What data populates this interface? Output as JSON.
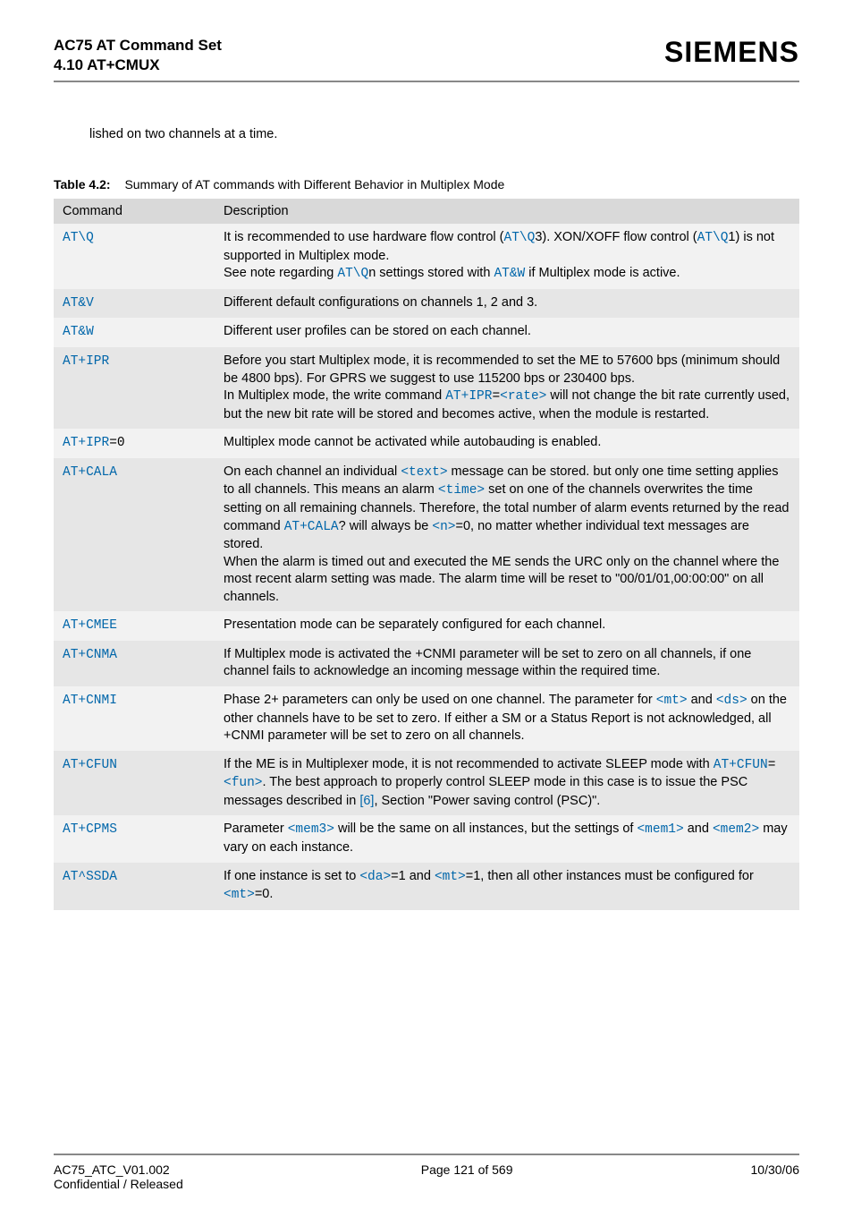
{
  "header": {
    "title_line1": "AC75 AT Command Set",
    "title_line2": "4.10 AT+CMUX",
    "brand": "SIEMENS"
  },
  "intro": "lished on two channels at a time.",
  "table_caption": {
    "label": "Table 4.2:",
    "text": "Summary of AT commands with Different Behavior in Multiplex Mode"
  },
  "columns": {
    "c1": "Command",
    "c2": "Description"
  },
  "rows": {
    "r0": {
      "cmd": "AT\\Q",
      "p1a": "It is recommended to use hardware flow control (",
      "p1b": "AT\\Q",
      "p1c": "3). XON/XOFF flow control (",
      "p1d": "AT\\Q",
      "p1e": "1) is not supported in Multiplex mode.",
      "p2a": "See note regarding ",
      "p2b": "AT\\Q",
      "p2c": "n settings stored with ",
      "p2d": "AT&W",
      "p2e": " if Multiplex mode is active."
    },
    "r1": {
      "cmd": "AT&V",
      "desc": "Different default configurations on channels 1, 2 and 3."
    },
    "r2": {
      "cmd": "AT&W",
      "desc": "Different user profiles can be stored on each channel."
    },
    "r3": {
      "cmd": "AT+IPR",
      "p1": "Before you start Multiplex mode, it is recommended to set the ME to 57600 bps (minimum should be 4800 bps). For GPRS we suggest to use 115200 bps or 230400 bps.",
      "p2a": "In Multiplex mode, the write command ",
      "p2b": "AT+IPR",
      "p2c": "=",
      "p2d": "<rate>",
      "p2e": " will not change the bit rate currently used, but the new bit rate will be stored and becomes active, when the module is restarted."
    },
    "r4": {
      "cmd1": "AT+IPR",
      "cmd2": "=0",
      "desc": "Multiplex mode cannot be activated while autobauding is enabled."
    },
    "r5": {
      "cmd": "AT+CALA",
      "a": "On each channel an individual ",
      "b": "<text>",
      "c": " message can be stored. but only one time setting applies to all channels. This means an alarm ",
      "d": "<time>",
      "e": " set on one of the channels overwrites the time setting on all remaining channels. Therefore, the total number of alarm events returned by the read command ",
      "f": "AT+CALA",
      "g": "? will always be ",
      "h": "<n>",
      "i": "=0, no matter whether individual text messages are stored.",
      "j": "When the alarm is timed out and executed the ME sends the URC only on the channel where the most recent alarm setting was made. The alarm time will be reset to \"00/01/01,00:00:00\" on all channels."
    },
    "r6": {
      "cmd": "AT+CMEE",
      "desc": "Presentation mode can be separately configured for each channel."
    },
    "r7": {
      "cmd": "AT+CNMA",
      "desc": "If Multiplex mode is activated the +CNMI parameter will be set to zero on all channels, if one channel fails to acknowledge an incoming message within the required time."
    },
    "r8": {
      "cmd": "AT+CNMI",
      "a": "Phase 2+ parameters can only be used on one channel. The parameter for ",
      "b": "<mt>",
      "c": " and ",
      "d": "<ds>",
      "e": " on the other channels have to be set to zero. If either a SM or a Status Report is not acknowledged, all +CNMI parameter will be set to zero on all channels."
    },
    "r9": {
      "cmd": "AT+CFUN",
      "a": "If the ME is in Multiplexer mode, it is not recommended to activate SLEEP mode with ",
      "b": "AT+CFUN",
      "c": "=",
      "d": "<fun>",
      "e": ". The best approach to properly control SLEEP mode in this case is to issue the PSC messages described in ",
      "f": "[6]",
      "g": ", Section \"Power saving control (PSC)\"."
    },
    "r10": {
      "cmd": "AT+CPMS",
      "a": "Parameter ",
      "b": "<mem3>",
      "c": " will be the same on all instances, but the settings of ",
      "d": "<mem1>",
      "e": " and ",
      "f": "<mem2>",
      "g": " may vary on each instance."
    },
    "r11": {
      "cmd": "AT^SSDA",
      "a": "If one instance is set to ",
      "b": "<da>",
      "c": "=1 and ",
      "d": "<mt>",
      "e": "=1, then all other instances must be configured for ",
      "f": "<mt>",
      "g": "=0."
    }
  },
  "footer": {
    "left1": "AC75_ATC_V01.002",
    "left2": "Confidential / Released",
    "center": "Page 121 of 569",
    "right": "10/30/06"
  }
}
